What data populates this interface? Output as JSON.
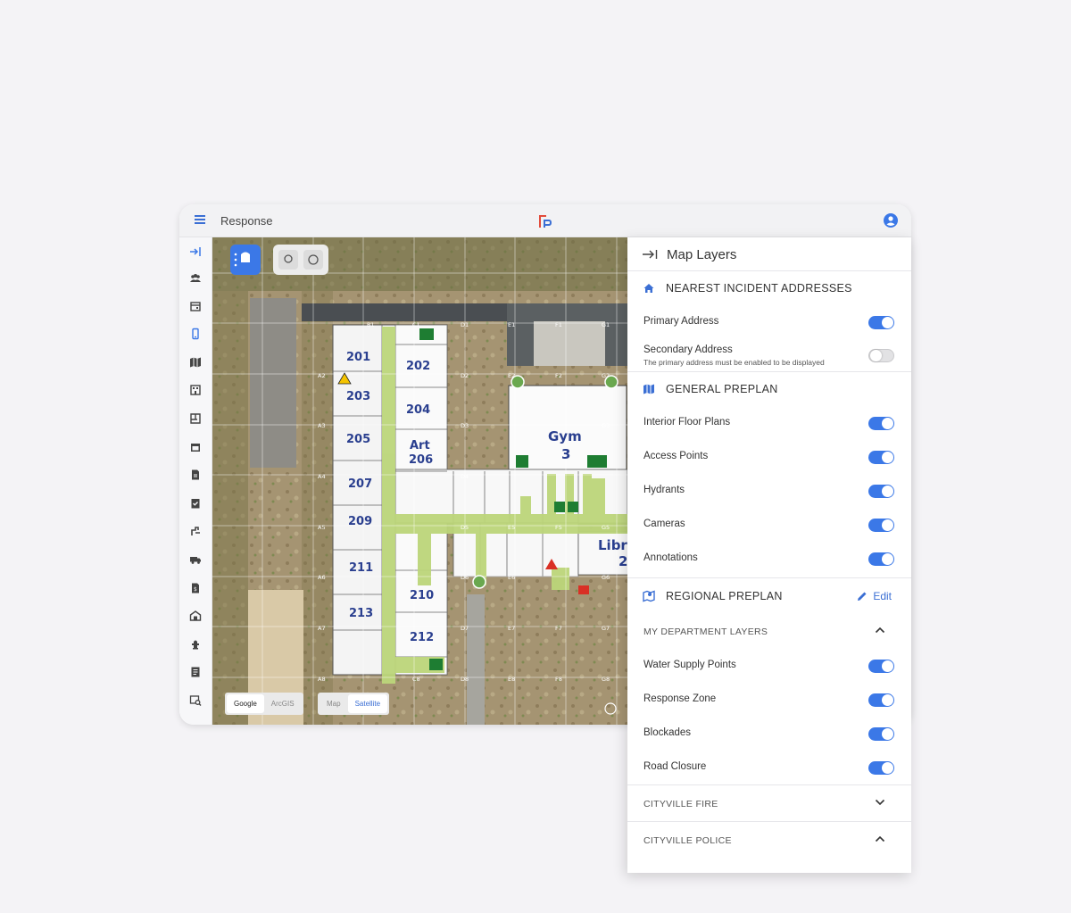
{
  "app": {
    "title": "Response"
  },
  "map": {
    "rooms": [
      "201",
      "202",
      "203",
      "204",
      "205",
      "Art",
      "206",
      "207",
      "209",
      "211",
      "213",
      "210",
      "212",
      "Gym",
      "3",
      "Libr",
      "2"
    ],
    "map_source_options": [
      "Google",
      "ArcGIS"
    ],
    "map_source_selected": "Google",
    "map_type_options": [
      "Map",
      "Satellite"
    ],
    "map_type_selected": "Satellite"
  },
  "panel": {
    "title": "Map Layers",
    "nearest": {
      "label": "NEAREST INCIDENT ADDRESSES",
      "primary": {
        "label": "Primary Address",
        "on": true
      },
      "secondary": {
        "label": "Secondary Address",
        "note": "The primary address must be enabled to be displayed",
        "on": false
      }
    },
    "general": {
      "label": "GENERAL PREPLAN",
      "items": [
        {
          "label": "Interior Floor Plans",
          "on": true
        },
        {
          "label": "Access Points",
          "on": true
        },
        {
          "label": "Hydrants",
          "on": true
        },
        {
          "label": "Cameras",
          "on": true
        },
        {
          "label": "Annotations",
          "on": true
        }
      ]
    },
    "regional": {
      "label": "REGIONAL PREPLAN",
      "edit_label": "Edit",
      "department": {
        "label": "MY DEPARTMENT LAYERS",
        "items": [
          {
            "label": "Water Supply Points",
            "on": true
          },
          {
            "label": "Response Zone",
            "on": true
          },
          {
            "label": "Blockades",
            "on": true
          },
          {
            "label": "Road Closure",
            "on": true
          }
        ]
      },
      "cityville_fire": "CITYVILLE FIRE",
      "cityville_police": "CITYVILLE POLICE"
    }
  },
  "colors": {
    "accent": "#3b78e7",
    "corridor": "#bcd67a",
    "room_text": "#2a3f8f"
  }
}
